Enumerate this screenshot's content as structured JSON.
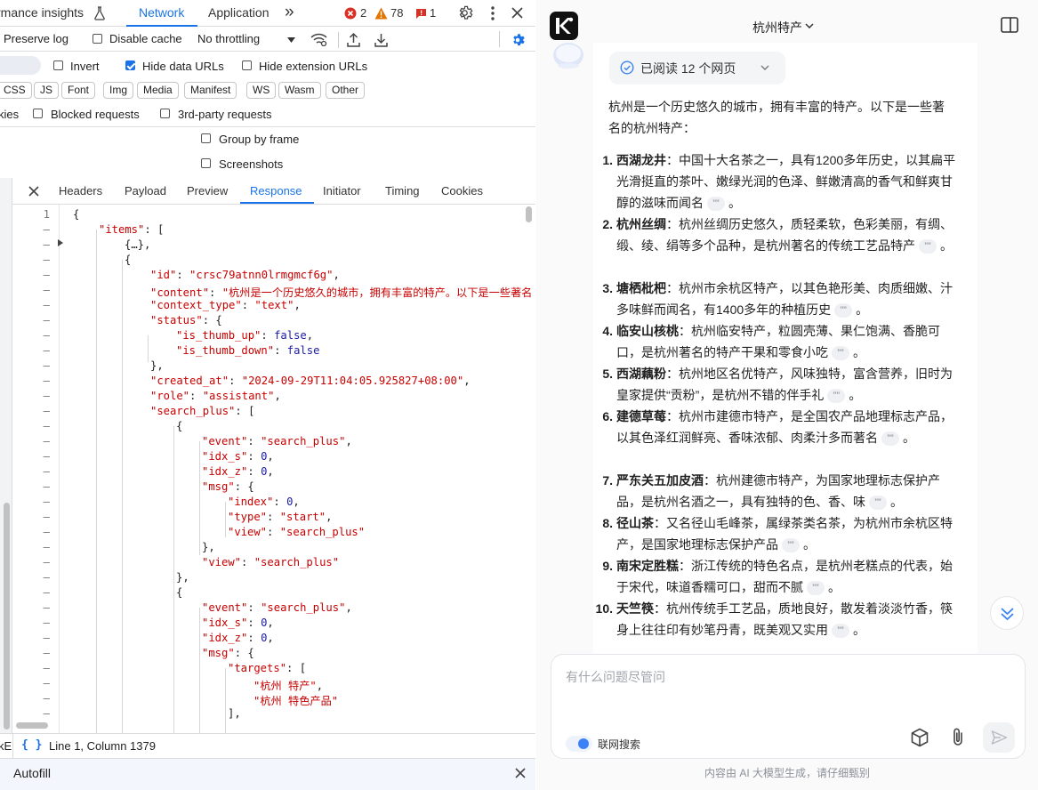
{
  "devtools": {
    "tabs": {
      "performance_insights": "rmance insights",
      "network": "Network",
      "application": "Application",
      "more": "»"
    },
    "counts": {
      "errors": "2",
      "warnings": "78",
      "issues": "1"
    },
    "toolbar": {
      "preserve_log": "Preserve log",
      "disable_cache": "Disable cache",
      "throttling": "No throttling"
    },
    "filters": {
      "invert": "Invert",
      "hide_data_urls": "Hide data URLs",
      "hide_extension_urls": "Hide extension URLs",
      "types": [
        "CSS",
        "JS",
        "Font",
        "Img",
        "Media",
        "Manifest",
        "WS",
        "Wasm",
        "Other"
      ],
      "cookies_partial": "kies",
      "blocked_requests": "Blocked requests",
      "third_party": "3rd-party requests",
      "group_by_frame": "Group by frame",
      "screenshots": "Screenshots"
    },
    "detail_tabs": [
      "Headers",
      "Payload",
      "Preview",
      "Response",
      "Initiator",
      "Timing",
      "Cookies"
    ],
    "detail_active": "Response",
    "code": {
      "first_line_number": "1",
      "other_marker": "–",
      "collapsed": "{…},"
    },
    "status": {
      "left_partial": "kE",
      "braces": "{ }",
      "position": "Line 1, Column 1379"
    },
    "drawer": {
      "title": "Autofill"
    }
  },
  "chat": {
    "header_title": "杭州特产",
    "read_pill": "已阅读 12 个网页",
    "intro": "杭州是一个历史悠久的城市，拥有丰富的特产。以下是一些著名的杭州特产：",
    "intro_line1": "杭州是一个历史悠久的城市，拥有丰富的特产。以下是一些著",
    "intro_line2": "名的杭州特产：",
    "items": [
      {
        "num": "1.",
        "name": "西湖龙井",
        "desc": "：中国十大名茶之一，具有1200多年历史，以其扁平光滑挺直的茶叶、嫩绿光润的色泽、鲜嫩清高的香气和鲜爽甘醇的滋味而闻名"
      },
      {
        "num": "2.",
        "name": "杭州丝绸",
        "desc": "：杭州丝绸历史悠久，质轻柔软，色彩美丽，有绸、缎、绫、绢等多个品种，是杭州著名的传统工艺品特产"
      },
      {
        "num": "3.",
        "name": "塘栖枇杷",
        "desc": "：杭州市余杭区特产，以其色艳形美、肉质细嫩、汁多味鲜而闻名，有1400多年的种植历史"
      },
      {
        "num": "4.",
        "name": "临安山核桃",
        "desc": "：杭州临安特产，粒圆壳薄、果仁饱满、香脆可口，是杭州著名的特产干果和零食小吃"
      },
      {
        "num": "5.",
        "name": "西湖藕粉",
        "desc": "：杭州地区名优特产，风味独特，富含营养，旧时为皇家提供“贡粉”，是杭州不错的伴手礼"
      },
      {
        "num": "6.",
        "name": "建德草莓",
        "desc": "：杭州市建德市特产，是全国农产品地理标志产品，以其色泽红润鲜亮、香味浓郁、肉柔汁多而著名"
      },
      {
        "num": "7.",
        "name": "严东关五加皮酒",
        "desc": "：杭州建德市特产，为国家地理标志保护产品，是杭州名酒之一，具有独特的色、香、味"
      },
      {
        "num": "8.",
        "name": "径山茶",
        "desc": "：又名径山毛峰茶，属绿茶类名茶，为杭州市余杭区特产，是国家地理标志保护产品"
      },
      {
        "num": "9.",
        "name": "南宋定胜糕",
        "desc": "：浙江传统的特色名点，是杭州老糕点的代表，始于宋代，味道香糯可口，甜而不腻"
      },
      {
        "num": "10.",
        "name": "天竺筷",
        "desc": "：杭州传统手工艺品，质地良好，散发着淡淡竹香，筷身上往往印有妙笔丹青，既美观又实用"
      }
    ],
    "cite_glyph": "”",
    "period": "。",
    "input_placeholder": "有什么问题尽管问",
    "web_search_label": "联网搜索",
    "footer_note": "内容由 AI 大模型生成，请仔细甄别"
  },
  "colors": {
    "devtools_accent": "#1a73e8",
    "json_key": "#c80000",
    "json_number": "#1a1aa6",
    "error_red": "#d93025",
    "warning_orange": "#e37400"
  }
}
